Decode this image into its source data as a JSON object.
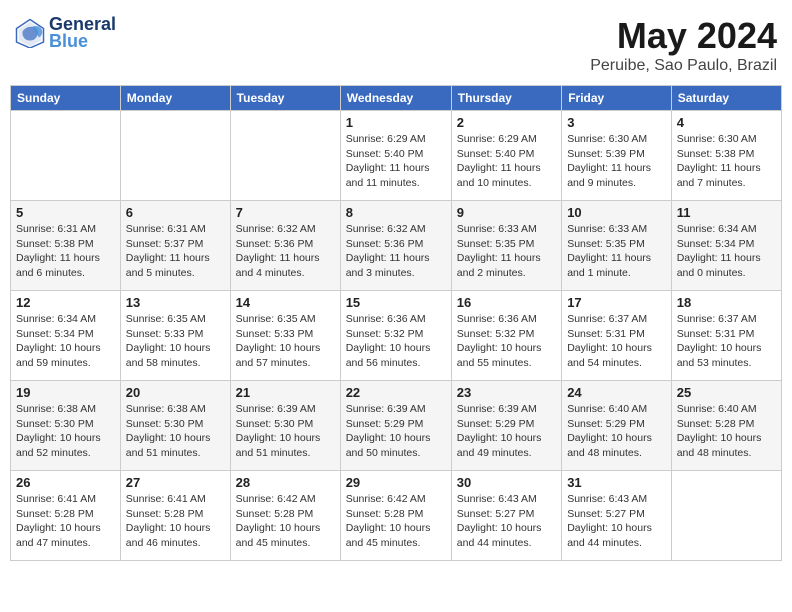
{
  "header": {
    "logo_line1": "General",
    "logo_line2": "Blue",
    "title": "May 2024",
    "subtitle": "Peruibe, Sao Paulo, Brazil"
  },
  "days_of_week": [
    "Sunday",
    "Monday",
    "Tuesday",
    "Wednesday",
    "Thursday",
    "Friday",
    "Saturday"
  ],
  "weeks": [
    [
      {
        "day": "",
        "info": ""
      },
      {
        "day": "",
        "info": ""
      },
      {
        "day": "",
        "info": ""
      },
      {
        "day": "1",
        "info": "Sunrise: 6:29 AM\nSunset: 5:40 PM\nDaylight: 11 hours\nand 11 minutes."
      },
      {
        "day": "2",
        "info": "Sunrise: 6:29 AM\nSunset: 5:40 PM\nDaylight: 11 hours\nand 10 minutes."
      },
      {
        "day": "3",
        "info": "Sunrise: 6:30 AM\nSunset: 5:39 PM\nDaylight: 11 hours\nand 9 minutes."
      },
      {
        "day": "4",
        "info": "Sunrise: 6:30 AM\nSunset: 5:38 PM\nDaylight: 11 hours\nand 7 minutes."
      }
    ],
    [
      {
        "day": "5",
        "info": "Sunrise: 6:31 AM\nSunset: 5:38 PM\nDaylight: 11 hours\nand 6 minutes."
      },
      {
        "day": "6",
        "info": "Sunrise: 6:31 AM\nSunset: 5:37 PM\nDaylight: 11 hours\nand 5 minutes."
      },
      {
        "day": "7",
        "info": "Sunrise: 6:32 AM\nSunset: 5:36 PM\nDaylight: 11 hours\nand 4 minutes."
      },
      {
        "day": "8",
        "info": "Sunrise: 6:32 AM\nSunset: 5:36 PM\nDaylight: 11 hours\nand 3 minutes."
      },
      {
        "day": "9",
        "info": "Sunrise: 6:33 AM\nSunset: 5:35 PM\nDaylight: 11 hours\nand 2 minutes."
      },
      {
        "day": "10",
        "info": "Sunrise: 6:33 AM\nSunset: 5:35 PM\nDaylight: 11 hours\nand 1 minute."
      },
      {
        "day": "11",
        "info": "Sunrise: 6:34 AM\nSunset: 5:34 PM\nDaylight: 11 hours\nand 0 minutes."
      }
    ],
    [
      {
        "day": "12",
        "info": "Sunrise: 6:34 AM\nSunset: 5:34 PM\nDaylight: 10 hours\nand 59 minutes."
      },
      {
        "day": "13",
        "info": "Sunrise: 6:35 AM\nSunset: 5:33 PM\nDaylight: 10 hours\nand 58 minutes."
      },
      {
        "day": "14",
        "info": "Sunrise: 6:35 AM\nSunset: 5:33 PM\nDaylight: 10 hours\nand 57 minutes."
      },
      {
        "day": "15",
        "info": "Sunrise: 6:36 AM\nSunset: 5:32 PM\nDaylight: 10 hours\nand 56 minutes."
      },
      {
        "day": "16",
        "info": "Sunrise: 6:36 AM\nSunset: 5:32 PM\nDaylight: 10 hours\nand 55 minutes."
      },
      {
        "day": "17",
        "info": "Sunrise: 6:37 AM\nSunset: 5:31 PM\nDaylight: 10 hours\nand 54 minutes."
      },
      {
        "day": "18",
        "info": "Sunrise: 6:37 AM\nSunset: 5:31 PM\nDaylight: 10 hours\nand 53 minutes."
      }
    ],
    [
      {
        "day": "19",
        "info": "Sunrise: 6:38 AM\nSunset: 5:30 PM\nDaylight: 10 hours\nand 52 minutes."
      },
      {
        "day": "20",
        "info": "Sunrise: 6:38 AM\nSunset: 5:30 PM\nDaylight: 10 hours\nand 51 minutes."
      },
      {
        "day": "21",
        "info": "Sunrise: 6:39 AM\nSunset: 5:30 PM\nDaylight: 10 hours\nand 51 minutes."
      },
      {
        "day": "22",
        "info": "Sunrise: 6:39 AM\nSunset: 5:29 PM\nDaylight: 10 hours\nand 50 minutes."
      },
      {
        "day": "23",
        "info": "Sunrise: 6:39 AM\nSunset: 5:29 PM\nDaylight: 10 hours\nand 49 minutes."
      },
      {
        "day": "24",
        "info": "Sunrise: 6:40 AM\nSunset: 5:29 PM\nDaylight: 10 hours\nand 48 minutes."
      },
      {
        "day": "25",
        "info": "Sunrise: 6:40 AM\nSunset: 5:28 PM\nDaylight: 10 hours\nand 48 minutes."
      }
    ],
    [
      {
        "day": "26",
        "info": "Sunrise: 6:41 AM\nSunset: 5:28 PM\nDaylight: 10 hours\nand 47 minutes."
      },
      {
        "day": "27",
        "info": "Sunrise: 6:41 AM\nSunset: 5:28 PM\nDaylight: 10 hours\nand 46 minutes."
      },
      {
        "day": "28",
        "info": "Sunrise: 6:42 AM\nSunset: 5:28 PM\nDaylight: 10 hours\nand 45 minutes."
      },
      {
        "day": "29",
        "info": "Sunrise: 6:42 AM\nSunset: 5:28 PM\nDaylight: 10 hours\nand 45 minutes."
      },
      {
        "day": "30",
        "info": "Sunrise: 6:43 AM\nSunset: 5:27 PM\nDaylight: 10 hours\nand 44 minutes."
      },
      {
        "day": "31",
        "info": "Sunrise: 6:43 AM\nSunset: 5:27 PM\nDaylight: 10 hours\nand 44 minutes."
      },
      {
        "day": "",
        "info": ""
      }
    ]
  ]
}
